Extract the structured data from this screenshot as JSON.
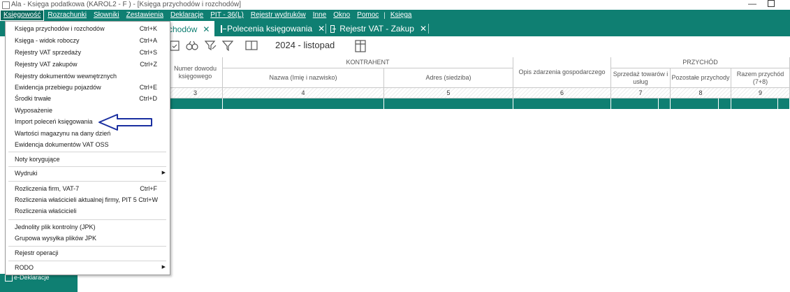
{
  "window": {
    "title": "Ala - Księga podatkowa (KAROL2 - F                    ) - [Księga przychodów i rozchodów]"
  },
  "menubar": {
    "items": [
      "Księgowość",
      "Rozrachunki",
      "Słowniki",
      "Zestawienia",
      "Deklaracje",
      "PIT - 36(L)",
      "Rejestr wydruków",
      "Inne",
      "Okno",
      "Pomoc"
    ],
    "separator": "|",
    "extra": "Księga"
  },
  "tabs": [
    {
      "label": "chodów",
      "close": "✕"
    },
    {
      "label": "Polecenia księgowania",
      "close": "✕"
    },
    {
      "label": "Rejestr VAT - Zakup",
      "close": "✕"
    }
  ],
  "toolbar": {
    "period": "2024 - listopad",
    "icons": [
      "calendar-check-icon",
      "binoculars-icon",
      "filter-edit-icon",
      "filter-icon",
      "book-icon",
      "columns-icon"
    ]
  },
  "table": {
    "headers": {
      "col3": "Numer dowodu księgowego",
      "kontrahent": "KONTRAHENT",
      "col4": "Nazwa (Imię i nazwisko)",
      "col5": "Adres (siedziba)",
      "col6": "Opis zdarzenia gospodarczego",
      "przychod": "PRZYCHÓD",
      "col7": "Sprzedaż towarów i usług",
      "col8": "Pozostałe przychody",
      "col9": "Razem przychód (7+8)"
    },
    "numbers": [
      "3",
      "4",
      "5",
      "6",
      "7",
      "8",
      "9"
    ]
  },
  "dropdown": {
    "items": [
      {
        "label": "Księga przychodów i rozchodów",
        "shortcut": "Ctrl+K"
      },
      {
        "label": "Księga - widok roboczy",
        "shortcut": "Ctrl+A"
      },
      {
        "label": "Rejestry VAT sprzedaży",
        "shortcut": "Ctrl+S"
      },
      {
        "label": "Rejestry VAT zakupów",
        "shortcut": "Ctrl+Z"
      },
      {
        "label": "Rejestry dokumentów wewnętrznych",
        "shortcut": ""
      },
      {
        "label": "Ewidencja przebiegu pojazdów",
        "shortcut": "Ctrl+E"
      },
      {
        "label": "Środki trwałe",
        "shortcut": "Ctrl+D"
      },
      {
        "label": "Wyposażenie",
        "shortcut": ""
      },
      {
        "label": "Import poleceń księgowania",
        "shortcut": ""
      },
      {
        "label": "Wartości magazynu na dany dzień",
        "shortcut": ""
      },
      {
        "label": "Ewidencja dokumentów VAT OSS",
        "shortcut": ""
      },
      {
        "label": "Noty korygujące",
        "shortcut": ""
      },
      {
        "label": "Wydruki",
        "shortcut": ""
      },
      {
        "label": "Rozliczenia firm,  VAT-7",
        "shortcut": "Ctrl+F"
      },
      {
        "label": "Rozliczenia właścicieli aktualnej firmy, PIT 5 Ctrl+W",
        "shortcut": ""
      },
      {
        "label": "Rozliczenia właścicieli",
        "shortcut": ""
      },
      {
        "label": "Jednolity plik kontrolny (JPK)",
        "shortcut": ""
      },
      {
        "label": "Grupowa wysyłka plików JPK",
        "shortcut": ""
      },
      {
        "label": "Rejestr operacji",
        "shortcut": ""
      },
      {
        "label": "RODO",
        "shortcut": ""
      }
    ],
    "submenu_arrow": "▶"
  },
  "sidebar": {
    "bottom_item": "e-Deklaracje"
  },
  "colors": {
    "accent": "#0f7f72",
    "annotation": "#1a2fa0"
  }
}
